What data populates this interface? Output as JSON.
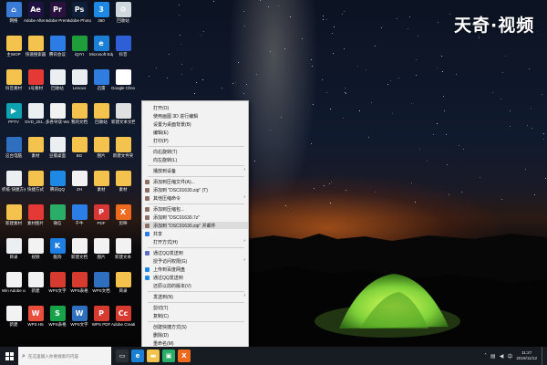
{
  "watermark": "天奇·视频",
  "desktop_icons": [
    {
      "label": "网络",
      "color": "#3a7bd5",
      "glyph": "⌂"
    },
    {
      "label": "Adobe After Effects CC 2019",
      "color": "#1f1242",
      "glyph": "Ae"
    },
    {
      "label": "Adobe Premiere P...",
      "color": "#2b1140",
      "glyph": "Pr"
    },
    {
      "label": "Adobe Photosh...",
      "color": "#0f1f3a",
      "glyph": "Ps"
    },
    {
      "label": "360",
      "color": "#1e88e5",
      "glyph": "3"
    },
    {
      "label": "回收站",
      "color": "#cfd8dc",
      "glyph": "♻"
    },
    {
      "label": "主WOP",
      "color": "#f3c34d",
      "glyph": ""
    },
    {
      "label": "快速搜索器",
      "color": "#f3c34d",
      "glyph": ""
    },
    {
      "label": "腾讯会议",
      "color": "#2d7be5",
      "glyph": ""
    },
    {
      "label": "iQIYI",
      "color": "#1f9d3a",
      "glyph": ""
    },
    {
      "label": "Microsoft Edge",
      "color": "#1b7fd6",
      "glyph": "e"
    },
    {
      "label": "抖音",
      "color": "#2e5fd6",
      "glyph": ""
    },
    {
      "label": "抖音素材",
      "color": "#f3c34d",
      "glyph": ""
    },
    {
      "label": "1号素材",
      "color": "#e53935",
      "glyph": ""
    },
    {
      "label": "回收站",
      "color": "#eceff1",
      "glyph": ""
    },
    {
      "label": "Lenovo",
      "color": "#e9eef0",
      "glyph": ""
    },
    {
      "label": "迅雷",
      "color": "#2f7de1",
      "glyph": ""
    },
    {
      "label": "Google Chrome",
      "color": "#ffffff",
      "glyph": "◎"
    },
    {
      "label": "PPTV",
      "color": "#0fa3b1",
      "glyph": "▶"
    },
    {
      "label": "DVD_201...",
      "color": "#eceff1",
      "glyph": ""
    },
    {
      "label": "多各导读-Word",
      "color": "#f2f2f2",
      "glyph": ""
    },
    {
      "label": "我的文档",
      "color": "#f3c34d",
      "glyph": ""
    },
    {
      "label": "回收站",
      "color": "#f3c34d",
      "glyph": ""
    },
    {
      "label": "新建文本文档",
      "color": "#e0e0e0",
      "glyph": ""
    },
    {
      "label": "这台电脑",
      "color": "#2f6fbf",
      "glyph": ""
    },
    {
      "label": "素材",
      "color": "#f3c34d",
      "glyph": ""
    },
    {
      "label": "豆瓣桌面",
      "color": "#eceff1",
      "glyph": ""
    },
    {
      "label": "BG",
      "color": "#f3c34d",
      "glyph": ""
    },
    {
      "label": "图片",
      "color": "#f3c34d",
      "glyph": ""
    },
    {
      "label": "新建文件夹",
      "color": "#f3c34d",
      "glyph": ""
    },
    {
      "label": "折纸·快捷方式",
      "color": "#eceff1",
      "glyph": ""
    },
    {
      "label": "快捷方式",
      "color": "#f3c34d",
      "glyph": ""
    },
    {
      "label": "腾讯QQ",
      "color": "#1e88e5",
      "glyph": ""
    },
    {
      "label": "ZH",
      "color": "#f2f2f2",
      "glyph": ""
    },
    {
      "label": "素材",
      "color": "#f3c34d",
      "glyph": ""
    },
    {
      "label": "素材",
      "color": "#f3c34d",
      "glyph": ""
    },
    {
      "label": "新建素材",
      "color": "#f3c34d",
      "glyph": ""
    },
    {
      "label": "素材图片",
      "color": "#e53935",
      "glyph": ""
    },
    {
      "label": "微信",
      "color": "#2aae67",
      "glyph": ""
    },
    {
      "label": "千牛",
      "color": "#2b7ee5",
      "glyph": ""
    },
    {
      "label": "PDF",
      "color": "#d93636",
      "glyph": "P"
    },
    {
      "label": "剪映",
      "color": "#ee6a1e",
      "glyph": "X"
    },
    {
      "label": "目录",
      "color": "#eceff1",
      "glyph": ""
    },
    {
      "label": "视频",
      "color": "#f2f2f2",
      "glyph": ""
    },
    {
      "label": "酷狗",
      "color": "#1d7ee4",
      "glyph": "K"
    },
    {
      "label": "新建文档",
      "color": "#f2f2f2",
      "glyph": ""
    },
    {
      "label": "图片",
      "color": "#f2f2f2",
      "glyph": ""
    },
    {
      "label": "新建文本",
      "color": "#f2f2f2",
      "glyph": ""
    },
    {
      "label": "Win Adobe cc 2019",
      "color": "#f2f2f2",
      "glyph": ""
    },
    {
      "label": "新建",
      "color": "#f2f2f2",
      "glyph": ""
    },
    {
      "label": "WPS文字",
      "color": "#d73a2f",
      "glyph": ""
    },
    {
      "label": "WPS表格",
      "color": "#d73a2f",
      "glyph": ""
    },
    {
      "label": "WPS文档",
      "color": "#2f6fbf",
      "glyph": ""
    },
    {
      "label": "目录",
      "color": "#f3c34d",
      "glyph": ""
    },
    {
      "label": "新建",
      "color": "#f2f2f2",
      "glyph": ""
    },
    {
      "label": "WPS H5",
      "color": "#ea4d3c",
      "glyph": "W"
    },
    {
      "label": "WPS表格",
      "color": "#17a34a",
      "glyph": "S"
    },
    {
      "label": "WPS文字",
      "color": "#2f6fbf",
      "glyph": "W"
    },
    {
      "label": "WPS PDF",
      "color": "#d73a2f",
      "glyph": "P"
    },
    {
      "label": "Adobe Creati...",
      "color": "#d73a2f",
      "glyph": "Cc"
    }
  ],
  "context_menu": {
    "items": [
      {
        "label": "打开(O)",
        "icon_color": "",
        "submenu": false,
        "highlighted": false
      },
      {
        "label": "使用画图 3D 进行编辑",
        "icon_color": "",
        "submenu": false,
        "highlighted": false
      },
      {
        "label": "设置为桌面背景(B)",
        "icon_color": "",
        "submenu": false,
        "highlighted": false
      },
      {
        "label": "编辑(E)",
        "icon_color": "",
        "submenu": false,
        "highlighted": false
      },
      {
        "label": "打印(P)",
        "icon_color": "",
        "submenu": false,
        "highlighted": false
      },
      {
        "sep": true
      },
      {
        "label": "向右旋转(T)",
        "icon_color": "",
        "submenu": false,
        "highlighted": false
      },
      {
        "label": "向左旋转(L)",
        "icon_color": "",
        "submenu": false,
        "highlighted": false
      },
      {
        "sep": true
      },
      {
        "label": "播放到设备",
        "icon_color": "",
        "submenu": true,
        "highlighted": false
      },
      {
        "sep": true
      },
      {
        "label": "添加到压缩文件(A)...",
        "icon_color": "#8d6e63",
        "submenu": false,
        "highlighted": false
      },
      {
        "label": "添加到 \"DSC01630.zip\" (T)",
        "icon_color": "#8d6e63",
        "submenu": false,
        "highlighted": false
      },
      {
        "label": "其他压缩命令",
        "icon_color": "#8d6e63",
        "submenu": true,
        "highlighted": false
      },
      {
        "sep": true
      },
      {
        "label": "添加到压缩包...",
        "icon_color": "#8d6e63",
        "submenu": false,
        "highlighted": false
      },
      {
        "label": "添加到 \"DSC01630.7z\"",
        "icon_color": "#8d6e63",
        "submenu": false,
        "highlighted": false
      },
      {
        "label": "添加到 \"DSC01630.zip\" 并邮件",
        "icon_color": "#8d6e63",
        "submenu": false,
        "highlighted": true
      },
      {
        "label": "共享",
        "icon_color": "#2b7be5",
        "submenu": false,
        "highlighted": false
      },
      {
        "label": "打开方式(H)",
        "icon_color": "",
        "submenu": true,
        "highlighted": false
      },
      {
        "sep": true
      },
      {
        "label": "通过QQ发送到",
        "icon_color": "#5c6bc0",
        "submenu": false,
        "highlighted": false
      },
      {
        "label": "授予访问权限(G)",
        "icon_color": "",
        "submenu": true,
        "highlighted": false
      },
      {
        "label": "上传到百度网盘",
        "icon_color": "#1e88e5",
        "submenu": false,
        "highlighted": false
      },
      {
        "label": "通过QQ发送到",
        "icon_color": "#1e88e5",
        "submenu": false,
        "highlighted": false
      },
      {
        "label": "还原以前的版本(V)",
        "icon_color": "",
        "submenu": false,
        "highlighted": false
      },
      {
        "sep": true
      },
      {
        "label": "发送到(N)",
        "icon_color": "",
        "submenu": true,
        "highlighted": false
      },
      {
        "sep": true
      },
      {
        "label": "剪切(T)",
        "icon_color": "",
        "submenu": false,
        "highlighted": false
      },
      {
        "label": "复制(C)",
        "icon_color": "",
        "submenu": false,
        "highlighted": false
      },
      {
        "sep": true
      },
      {
        "label": "创建快捷方式(S)",
        "icon_color": "",
        "submenu": false,
        "highlighted": false
      },
      {
        "label": "删除(D)",
        "icon_color": "",
        "submenu": false,
        "highlighted": false
      },
      {
        "label": "重命名(M)",
        "icon_color": "",
        "submenu": false,
        "highlighted": false
      },
      {
        "sep": true
      },
      {
        "label": "属性(R)",
        "icon_color": "",
        "submenu": false,
        "highlighted": false
      }
    ]
  },
  "taskbar": {
    "search_placeholder": "在这里输入你要搜索的内容",
    "pinned": [
      {
        "name": "task-view",
        "color": "#2a2f38",
        "glyph": "▭"
      },
      {
        "name": "edge",
        "color": "#1b7fd6",
        "glyph": "e"
      },
      {
        "name": "file-explorer",
        "color": "#f3c34d",
        "glyph": "▬"
      },
      {
        "name": "app-green",
        "color": "#2aae67",
        "glyph": "▣"
      },
      {
        "name": "app-orange",
        "color": "#ee6a1e",
        "glyph": "X"
      }
    ],
    "clock_time": "11:27",
    "clock_date": "2019/11/12"
  }
}
